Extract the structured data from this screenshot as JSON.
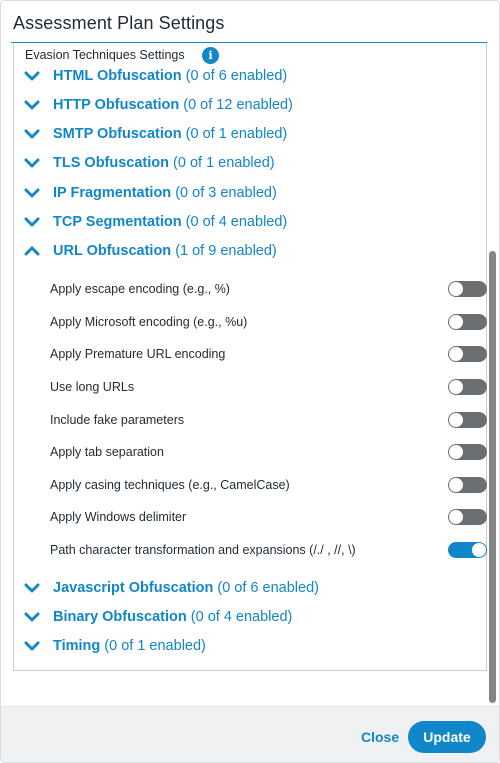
{
  "dialog": {
    "title": "Assessment Plan Settings"
  },
  "panel": {
    "title": "Evasion Techniques Settings",
    "info_icon": "i"
  },
  "sections": [
    {
      "name": "HTML Obfuscation",
      "count": "(0 of 6 enabled)",
      "expanded": false
    },
    {
      "name": "HTTP Obfuscation",
      "count": "(0 of 12 enabled)",
      "expanded": false
    },
    {
      "name": "SMTP Obfuscation",
      "count": "(0 of 1 enabled)",
      "expanded": false
    },
    {
      "name": "TLS Obfuscation",
      "count": "(0 of 1 enabled)",
      "expanded": false
    },
    {
      "name": "IP Fragmentation",
      "count": "(0 of 3 enabled)",
      "expanded": false
    },
    {
      "name": "TCP Segmentation",
      "count": "(0 of 4 enabled)",
      "expanded": false
    },
    {
      "name": "URL Obfuscation",
      "count": "(1 of 9 enabled)",
      "expanded": true
    },
    {
      "name": "Javascript Obfuscation",
      "count": "(0 of 6 enabled)",
      "expanded": false
    },
    {
      "name": "Binary Obfuscation",
      "count": "(0 of 4 enabled)",
      "expanded": false
    },
    {
      "name": "Timing",
      "count": "(0 of 1 enabled)",
      "expanded": false
    }
  ],
  "url_options": [
    {
      "label": "Apply escape encoding (e.g., %)",
      "enabled": false
    },
    {
      "label": "Apply Microsoft encoding (e.g., %u)",
      "enabled": false
    },
    {
      "label": "Apply Premature URL encoding",
      "enabled": false
    },
    {
      "label": "Use long URLs",
      "enabled": false
    },
    {
      "label": "Include fake parameters",
      "enabled": false
    },
    {
      "label": "Apply tab separation",
      "enabled": false
    },
    {
      "label": "Apply casing techniques (e.g., CamelCase)",
      "enabled": false
    },
    {
      "label": "Apply Windows delimiter",
      "enabled": false
    },
    {
      "label": "Path character transformation and expansions (/./ , //, \\)",
      "enabled": true
    }
  ],
  "footer": {
    "close_label": "Close",
    "update_label": "Update"
  },
  "icons": {
    "chevron_collapsed": "chevron-down-icon",
    "chevron_expanded": "chevron-up-icon",
    "info": "info-icon"
  },
  "colors": {
    "accent": "#1186c8",
    "toggle_off": "#6c6f72",
    "footer_bg": "#f0f1f2"
  }
}
